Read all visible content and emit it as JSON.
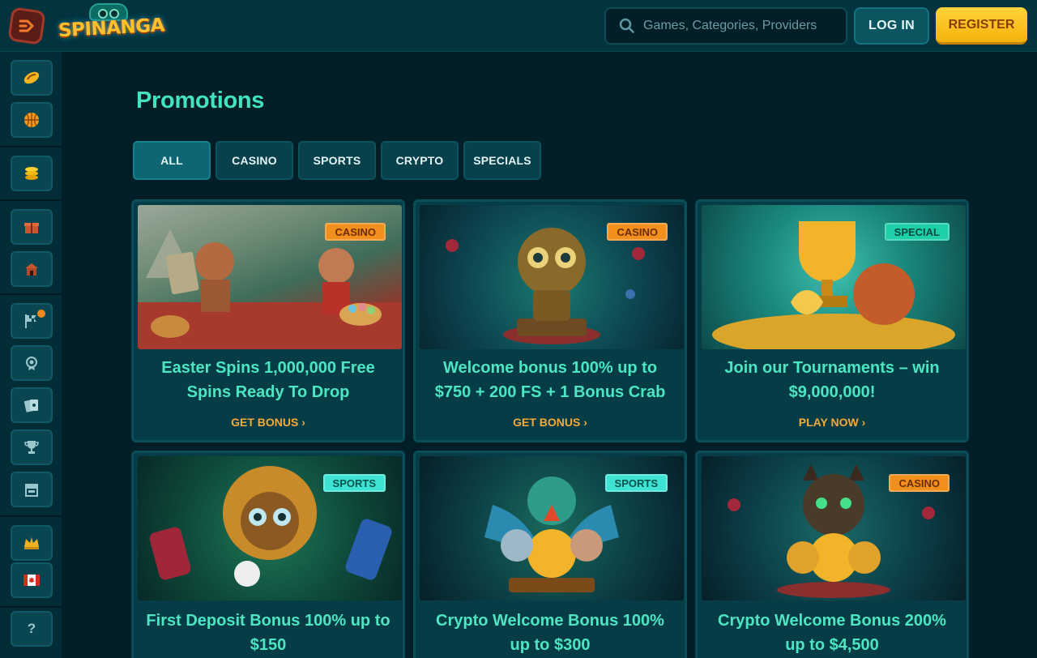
{
  "header": {
    "brand": "SPINANGA",
    "search_placeholder": "Games, Categories, Providers",
    "login_label": "LOG IN",
    "register_label": "REGISTER"
  },
  "sidebar": {
    "items": [
      {
        "icon": "casino-chip-icon"
      },
      {
        "icon": "basketball-icon"
      },
      {
        "icon": "gold-coin-stack-icon"
      },
      {
        "icon": "gift-icon"
      },
      {
        "icon": "temple-icon"
      },
      {
        "icon": "race-flag-icon"
      },
      {
        "icon": "medal-icon"
      },
      {
        "icon": "cards-icon"
      },
      {
        "icon": "trophy-icon"
      },
      {
        "icon": "shop-icon"
      },
      {
        "icon": "crown-icon"
      },
      {
        "icon": "canada-flag-icon"
      },
      {
        "icon": "help-icon",
        "label": "?"
      }
    ]
  },
  "main": {
    "title": "Promotions",
    "tabs": [
      {
        "label": "ALL",
        "active": true
      },
      {
        "label": "CASINO"
      },
      {
        "label": "SPORTS"
      },
      {
        "label": "CRYPTO"
      },
      {
        "label": "SPECIALS"
      }
    ],
    "promotions": [
      {
        "badge": "CASINO",
        "title": "Easter Spins 1,000,000 Free Spins Ready To Drop",
        "cta": "GET BONUS"
      },
      {
        "badge": "CASINO",
        "title": "Welcome bonus 100% up to $750 + 200 FS + 1 Bonus Crab",
        "cta": "GET BONUS"
      },
      {
        "badge": "SPECIAL",
        "title": "Join our Tournaments – win $9,000,000!",
        "cta": "PLAY NOW"
      },
      {
        "badge": "SPORTS",
        "title": "First Deposit Bonus 100% up to $150",
        "cta": ""
      },
      {
        "badge": "SPORTS",
        "title": "Crypto Welcome Bonus 100% up to $300",
        "cta": ""
      },
      {
        "badge": "CASINO",
        "title": "Crypto Welcome Bonus 200% up to $4,500",
        "cta": ""
      }
    ]
  },
  "colors": {
    "accent": "#43e3bf",
    "cta": "#f4a93b",
    "register": "#ffc22e",
    "background": "#021e26"
  }
}
